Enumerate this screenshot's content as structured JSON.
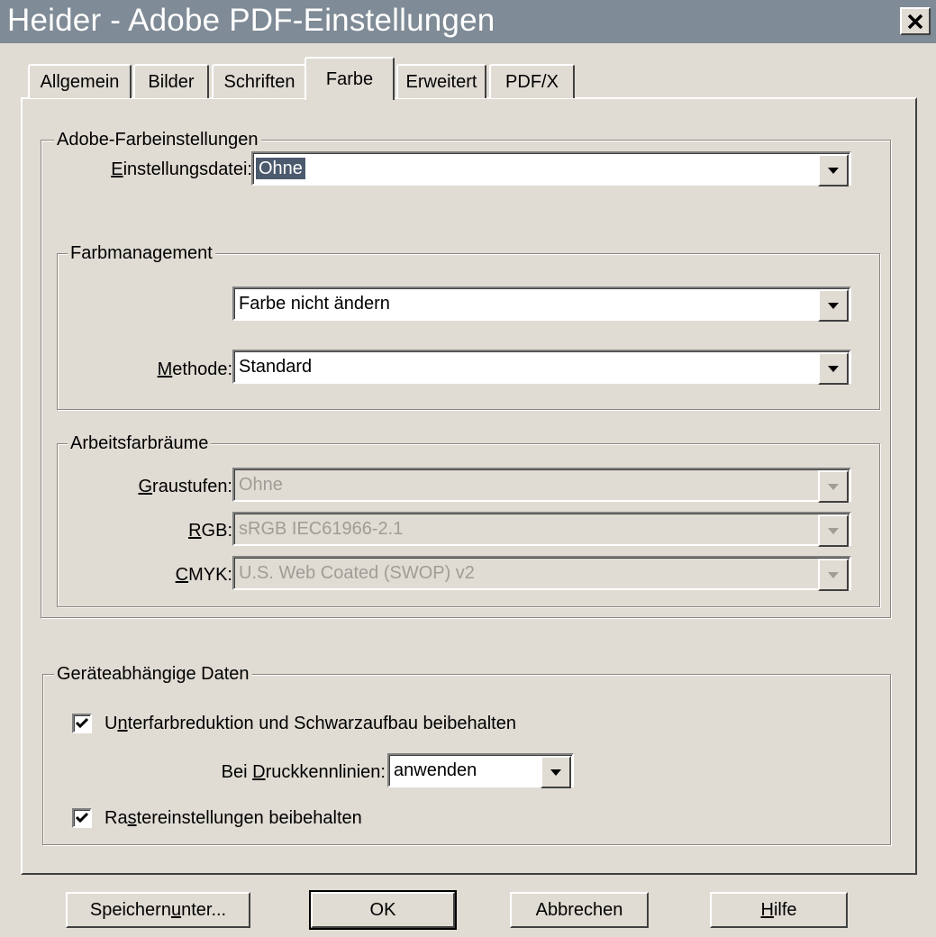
{
  "window": {
    "title": "Heider - Adobe PDF-Einstellungen",
    "close_icon": "close-icon"
  },
  "tabs": [
    {
      "label": "Allgemein",
      "active": false
    },
    {
      "label": "Bilder",
      "active": false
    },
    {
      "label": "Schriften",
      "active": false
    },
    {
      "label": "Farbe",
      "active": true
    },
    {
      "label": "Erweitert",
      "active": false
    },
    {
      "label": "PDF/X",
      "active": false
    }
  ],
  "adobe_color": {
    "legend": "Adobe-Farbeinstellungen",
    "settings_file_label": "Einstellungsdatei:",
    "settings_file_value": "Ohne"
  },
  "color_management": {
    "legend": "Farbmanagement",
    "policy_value": "Farbe nicht ändern",
    "method_label": "Methode:",
    "method_value": "Standard"
  },
  "working_spaces": {
    "legend": "Arbeitsfarbräume",
    "gray_label": "Graustufen:",
    "gray_value": "Ohne",
    "rgb_label": "RGB:",
    "rgb_value": "sRGB IEC61966-2.1",
    "cmyk_label": "CMYK:",
    "cmyk_value": "U.S. Web Coated (SWOP) v2"
  },
  "device_data": {
    "legend": "Geräteabhängige Daten",
    "ucr_label": "Unterfarbreduktion und Schwarzaufbau beibehalten",
    "ucr_checked": true,
    "transfer_label": "Bei Druckkennlinien:",
    "transfer_value": "anwenden",
    "halftone_label": "Rastereinstellungen beibehalten",
    "halftone_checked": true
  },
  "buttons": {
    "save_as": "Speichern unter...",
    "ok": "OK",
    "cancel": "Abbrechen",
    "help": "Hilfe"
  },
  "colors": {
    "titlebar": "#7f8b96",
    "dialog": "#e0dcd4",
    "selection": "#4c5a6e"
  }
}
